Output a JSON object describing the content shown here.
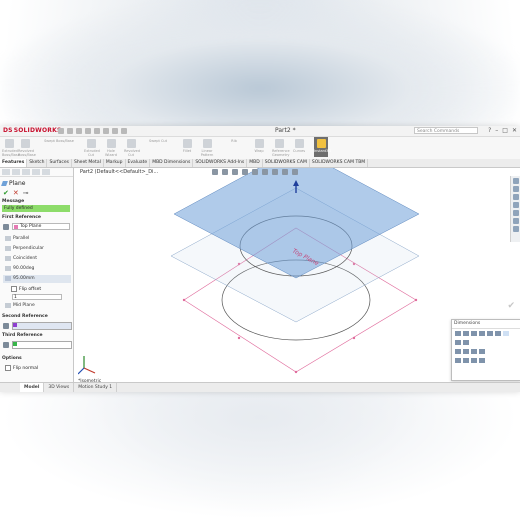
{
  "app": {
    "logo": "SOLIDWORKS",
    "doc_title": "Part2 *",
    "search_placeholder": "Search Commands",
    "window_buttons": [
      "?",
      "–",
      "□",
      "✕"
    ]
  },
  "command_manager": {
    "tools": [
      "Extruded Boss/Base",
      "Revolved Boss/Base",
      "Swept Boss/Base",
      "Lofted Boss/Base",
      "Boundary Boss/Base",
      "Extruded Cut",
      "Hole Wizard",
      "Revolved Cut",
      "Swept Cut",
      "Lofted Cut",
      "Boundary Cut",
      "Fillet",
      "Linear Pattern",
      "Rib",
      "Draft",
      "Shell",
      "Wrap",
      "Intersect",
      "Reference Geometry",
      "Curves",
      "Mirror"
    ],
    "instant3d_label": "Instant3D"
  },
  "tabs": [
    "Features",
    "Sketch",
    "Surfaces",
    "Sheet Metal",
    "Markup",
    "Evaluate",
    "MBD Dimensions",
    "SOLIDWORKS Add-Ins",
    "MBD",
    "SOLIDWORKS CAM",
    "SOLIDWORKS CAM TBM"
  ],
  "active_tab": "Features",
  "property_manager": {
    "title": "Plane",
    "message_header": "Message",
    "message": "Fully defined",
    "first_reference_header": "First Reference",
    "first_reference_value": "Top Plane",
    "first_reference_color": "#e67ab4",
    "options": [
      "Parallel",
      "Perpendicular",
      "Coincident",
      "90.00deg",
      "95.00mm"
    ],
    "selected_option": "95.00mm",
    "flip_offset_label": "Flip offset",
    "count_value": "1",
    "mid_plane_label": "Mid Plane",
    "second_reference_header": "Second Reference",
    "second_reference_color": "#8e3fd0",
    "third_reference_header": "Third Reference",
    "third_reference_color": "#38b64a",
    "options_header": "Options",
    "flip_normal_label": "Flip normal"
  },
  "graphics": {
    "breadcrumb": "Part2 (Default<<Default>_Di...",
    "plane_label": "Top Plane",
    "view_label": "*Isometric",
    "dimensions_title": "Dimensions"
  },
  "bottom_tabs": [
    "Model",
    "3D Views",
    "Motion Study 1"
  ],
  "active_bottom_tab": "Model",
  "colors": {
    "message_bg": "#8ddc6a",
    "new_plane": "#6fa1d8",
    "sketch_lines": "#e06b9c"
  }
}
